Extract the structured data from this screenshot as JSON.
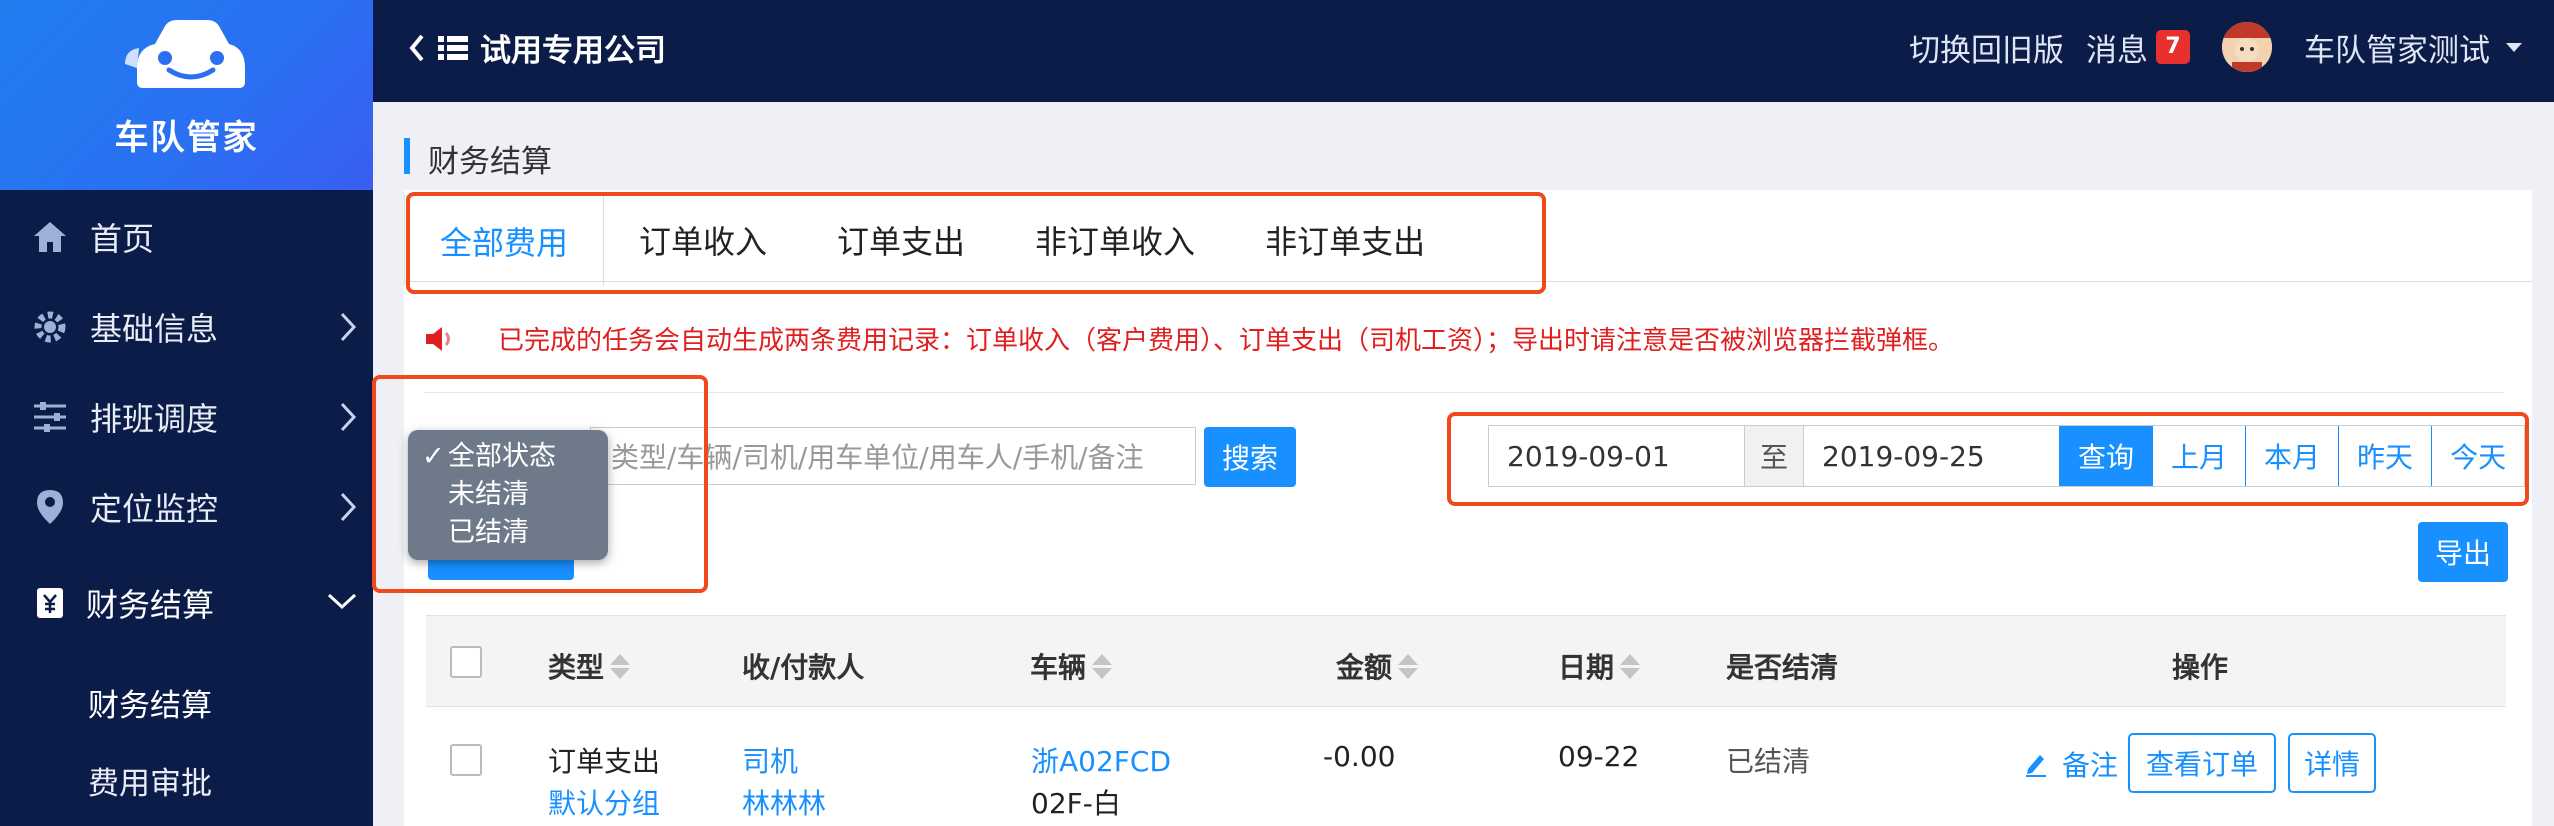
{
  "brand": {
    "name": "车队管家",
    "colors": {
      "sidebar": "#0b1c48",
      "brand_gradient": "#2b6ff2",
      "accent": "#1890ff",
      "highlight": "#f04a1c"
    }
  },
  "sidebar": {
    "items": [
      {
        "label": "首页",
        "icon": "home-icon"
      },
      {
        "label": "基础信息",
        "icon": "gear-icon",
        "arrow": "chevron-right-icon"
      },
      {
        "label": "排班调度",
        "icon": "sliders-icon",
        "arrow": "chevron-right-icon"
      },
      {
        "label": "定位监控",
        "icon": "location-pin-icon",
        "arrow": "chevron-right-icon"
      },
      {
        "label": "财务结算",
        "icon": "finance-icon",
        "arrow": "chevron-down-icon"
      }
    ],
    "subitems": [
      {
        "label": "财务结算"
      },
      {
        "label": "费用审批"
      }
    ]
  },
  "header": {
    "company": "试用专用公司",
    "switch_old": "切换回旧版",
    "messages": "消息",
    "message_count": "7",
    "user": "车队管家测试"
  },
  "page": {
    "title": "财务结算"
  },
  "tabs": [
    {
      "label": "全部费用",
      "active": true
    },
    {
      "label": "订单收入"
    },
    {
      "label": "订单支出"
    },
    {
      "label": "非订单收入"
    },
    {
      "label": "非订单支出"
    }
  ],
  "notice": "已完成的任务会自动生成两条费用记录：订单收入（客户费用）、订单支出（司机工资）；导出时请注意是否被浏览器拦截弹框。",
  "filters": {
    "status_options": [
      "全部状态",
      "未结清",
      "已结清"
    ],
    "status_selected": "全部状态",
    "search_placeholder": "类型/车辆/司机/用车单位/用车人/手机/备注",
    "search_button": "搜索",
    "date_from": "2019-09-01",
    "date_sep": "至",
    "date_to": "2019-09-25",
    "quick": [
      "查询",
      "上月",
      "本月",
      "昨天",
      "今天"
    ],
    "export": "导出"
  },
  "table": {
    "headers": [
      "类型",
      "收/付款人",
      "车辆",
      "金额",
      "日期",
      "是否结清",
      "操作"
    ],
    "rows": [
      {
        "type": "订单支出",
        "group": "默认分组",
        "payee_role": "司机",
        "payee_name": "林林林",
        "plate": "浙A02FCD",
        "vehicle_desc": "02F-白",
        "amount": "-0.00",
        "date": "09-22",
        "settled": "已结清",
        "note_action": "备注",
        "view_order": "查看订单",
        "details": "详情"
      }
    ]
  }
}
